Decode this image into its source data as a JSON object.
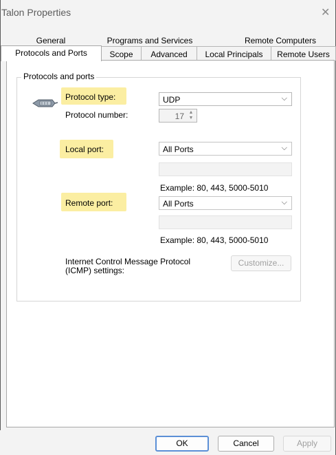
{
  "window": {
    "title": "Talon Properties",
    "close_glyph": "✕"
  },
  "tabs_back": [
    {
      "label": "General"
    },
    {
      "label": "Programs and Services"
    },
    {
      "label": "Remote Computers"
    }
  ],
  "tabs_front": [
    {
      "label": "Protocols and Ports",
      "active": true
    },
    {
      "label": "Scope"
    },
    {
      "label": "Advanced"
    },
    {
      "label": "Local Principals"
    },
    {
      "label": "Remote Users"
    }
  ],
  "group": {
    "title": "Protocols and ports"
  },
  "protocol": {
    "type_label": "Protocol type:",
    "type_value": "UDP",
    "number_label": "Protocol number:",
    "number_value": "17"
  },
  "local_port": {
    "label": "Local port:",
    "value": "All Ports",
    "example": "Example: 80, 443, 5000-5010"
  },
  "remote_port": {
    "label": "Remote port:",
    "value": "All Ports",
    "example": "Example: 80, 443, 5000-5010"
  },
  "icmp": {
    "label_line1": "Internet Control Message Protocol",
    "label_line2": "(ICMP) settings:",
    "button": "Customize..."
  },
  "buttons": {
    "ok": "OK",
    "cancel": "Cancel",
    "apply": "Apply"
  },
  "icons": {
    "protocol": "network-plug-icon",
    "dropdown": "chevron-down-icon",
    "spinner": "spinner-arrows-icon"
  },
  "colors": {
    "highlight": "#fbeea2",
    "border": "#a8a8a8",
    "window_bg": "#f3f3f3"
  }
}
